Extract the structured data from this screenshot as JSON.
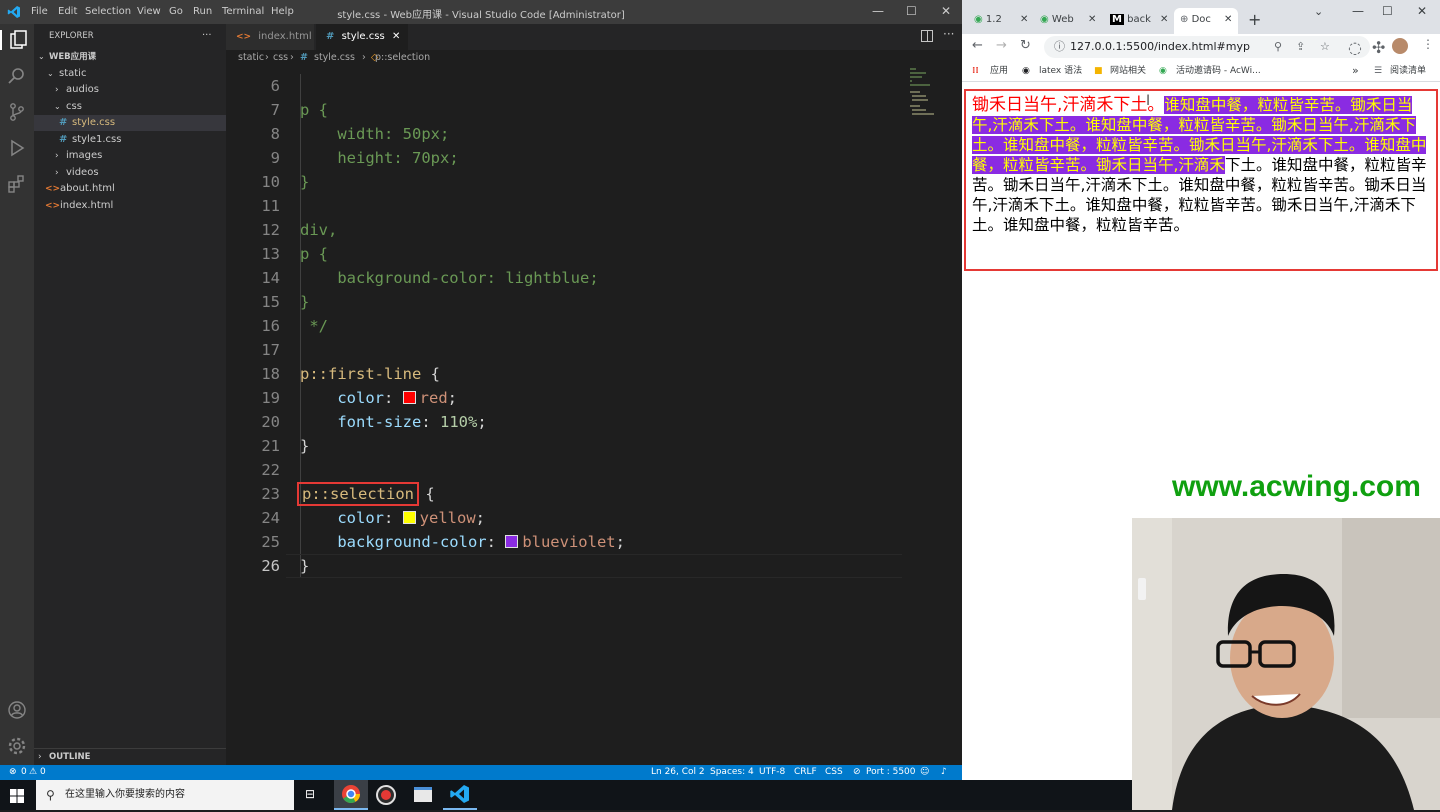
{
  "vscode": {
    "menu": [
      "File",
      "Edit",
      "Selection",
      "View",
      "Go",
      "Run",
      "Terminal",
      "Help"
    ],
    "window_title": "style.css - Web应用课 - Visual Studio Code [Administrator]",
    "explorer": {
      "header": "EXPLORER",
      "project": "WEB应用课",
      "tree": [
        {
          "label": "static",
          "kind": "folder-open"
        },
        {
          "label": "audios",
          "kind": "folder"
        },
        {
          "label": "css",
          "kind": "folder-open"
        },
        {
          "label": "style.css",
          "kind": "css",
          "selected": true
        },
        {
          "label": "style1.css",
          "kind": "css"
        },
        {
          "label": "images",
          "kind": "folder"
        },
        {
          "label": "videos",
          "kind": "folder"
        },
        {
          "label": "about.html",
          "kind": "html"
        },
        {
          "label": "index.html",
          "kind": "html"
        }
      ],
      "outline": "OUTLINE"
    },
    "tabs": [
      {
        "label": "index.html",
        "active": false
      },
      {
        "label": "style.css",
        "active": true
      }
    ],
    "breadcrumb": [
      "static",
      "css",
      "style.css",
      "p::selection"
    ],
    "code": {
      "line_numbers": [
        "6",
        "7",
        "8",
        "9",
        "10",
        "11",
        "12",
        "13",
        "14",
        "15",
        "16",
        "17",
        "18",
        "19",
        "20",
        "21",
        "22",
        "23",
        "24",
        "25",
        "26"
      ],
      "l7_sel": "p",
      "l7_rest": " {",
      "l8_prop": "    width",
      "l8_val": "50px",
      "l9_prop": "    height",
      "l9_val": "70px",
      "l10": "}",
      "l12": "div,",
      "l13": "p {",
      "l14_prop": "    background-color",
      "l14_val": "lightblue",
      "l15": "}",
      "l16": " */",
      "l18_sel": "p::first-line",
      "l18_rest": " {",
      "l19_prop": "    color",
      "l19_val": "red",
      "l19_color": "#ff0000",
      "l20_prop": "    font-size",
      "l20_val": "110%",
      "l21": "}",
      "l23_sel": "p::selection",
      "l23_rest": " {",
      "l24_prop": "    color",
      "l24_val": "yellow",
      "l24_color": "#ffff00",
      "l25_prop": "    background-color",
      "l25_val": "blueviolet",
      "l25_color": "#8a2be2",
      "l26": "}"
    },
    "status": {
      "problems": "0",
      "warnings": "0",
      "position": "Ln 26, Col 2",
      "spaces": "Spaces: 4",
      "encoding": "UTF-8",
      "eol": "CRLF",
      "language": "CSS",
      "port": "Port : 5500"
    }
  },
  "browser": {
    "tabs": [
      "1.2",
      "Web",
      "back",
      "Doc"
    ],
    "url": "127.0.0.1:5500/index.html#myp",
    "bookmarks": [
      "应用",
      "latex 语法",
      "网站相关",
      "活动邀请码 - AcWi...",
      "阅读清单"
    ],
    "para_first": "锄禾日当午,汗滴禾下土。",
    "para_selected": "谁知盘中餐，粒粒皆辛苦。锄禾日当午,汗滴禾下土。谁知盘中餐，粒粒皆辛苦。锄禾日当午,汗滴禾下土。谁知盘中餐，粒粒皆辛苦。锄禾日当午,汗滴禾下土。谁知盘中餐，粒粒皆辛苦。锄禾日当午,汗滴禾",
    "para_rest": "下土。谁知盘中餐，粒粒皆辛苦。锄禾日当午,汗滴禾下土。谁知盘中餐，粒粒皆辛苦。锄禾日当午,汗滴禾下土。谁知盘中餐，粒粒皆辛苦。锄禾日当午,汗滴禾下土。谁知盘中餐，粒粒皆辛苦。"
  },
  "watermark": "www.acwing.com",
  "taskbar": {
    "search_placeholder": "在这里输入你要搜索的内容"
  },
  "colors": {
    "accent": "#007acc",
    "selection_bg": "#8a2be2",
    "selection_fg": "#ffff00",
    "first_line": "#ff0000",
    "highlight_box": "#e53935",
    "watermark": "#10a010"
  }
}
